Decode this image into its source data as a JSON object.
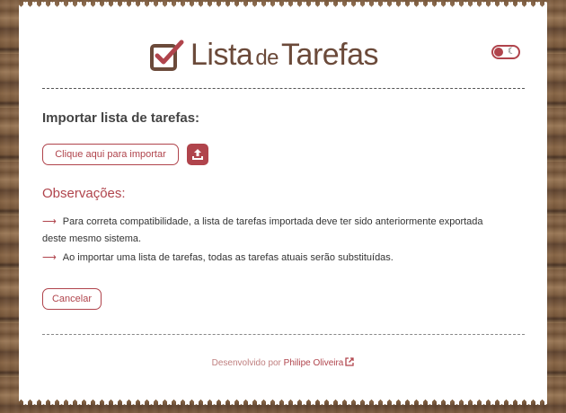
{
  "app": {
    "logo_main": "Lista",
    "logo_de": "de",
    "logo_end": "Tarefas"
  },
  "theme_toggle": {
    "moon_icon": "☾"
  },
  "import_section": {
    "title": "Importar lista de tarefas:",
    "import_button": "Clique aqui para importar"
  },
  "observations": {
    "title": "Observações:",
    "arrow": "⟶",
    "notes": [
      "Para correta compatibilidade, a lista de tarefas importada deve ter sido anteriormente exportada deste mesmo sistema.",
      "Ao importar uma lista de tarefas, todas as tarefas atuais serão substituídas."
    ]
  },
  "actions": {
    "cancel": "Cancelar"
  },
  "footer": {
    "prefix": "Desenvolvido por",
    "author": "Philipe Oliveira"
  },
  "colors": {
    "accent": "#b0444c",
    "brand_brown": "#6b4a3a"
  }
}
